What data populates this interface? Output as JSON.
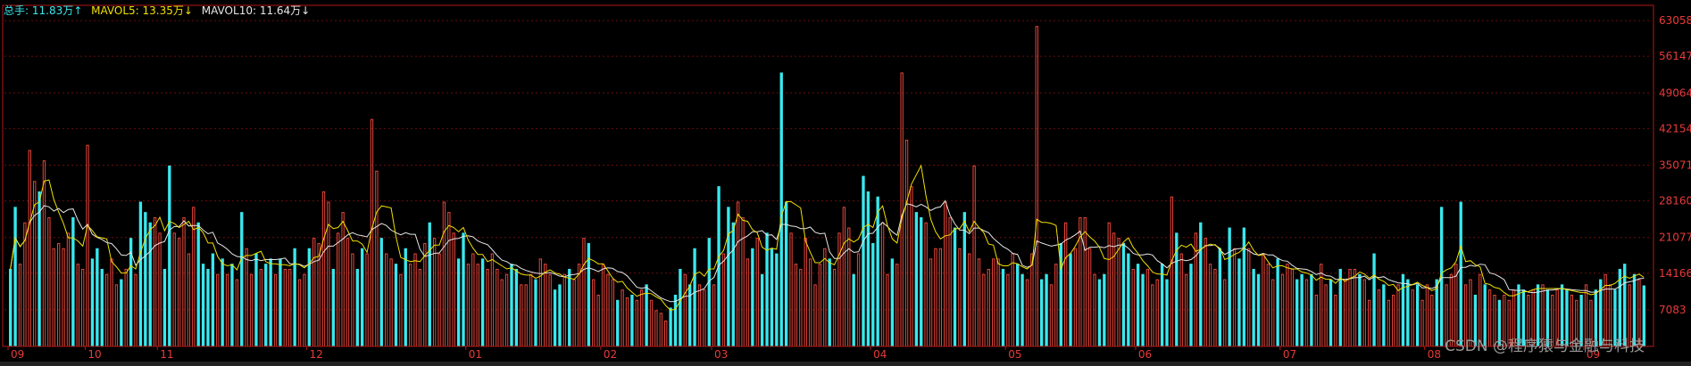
{
  "legend": {
    "total_label": "总手: 11.83万↑",
    "mavol5_label": "MAVOL5: 13.35万↓",
    "mavol10_label": "MAVOL10: 11.64万↓",
    "colors": {
      "total": "#38e8ee",
      "mavol5": "#f0e000",
      "mavol10": "#e6e6e6"
    }
  },
  "watermark": "CSDN @程序猿与金融与科技",
  "chart_data": {
    "type": "bar",
    "title": "",
    "ylim": [
      0,
      66000
    ],
    "y_ticks": [
      7083,
      14166,
      21077,
      28160,
      35071,
      42154,
      49064,
      56147,
      63058
    ],
    "x_month_labels": [
      "09",
      "10",
      "11",
      "12",
      "01",
      "02",
      "03",
      "04",
      "05",
      "06",
      "07",
      "08",
      "09"
    ],
    "x_month_start_index": [
      0,
      16,
      31,
      62,
      95,
      123,
      146,
      179,
      207,
      234,
      264,
      294,
      327
    ],
    "bar_colors": {
      "up": "#e8463a",
      "down": "#38e8ee"
    },
    "values": [
      15000,
      27000,
      16000,
      24000,
      38000,
      32000,
      30000,
      36000,
      25000,
      19000,
      20000,
      19000,
      22000,
      25000,
      16000,
      15000,
      39000,
      17000,
      19000,
      15000,
      14000,
      17000,
      12000,
      13000,
      15000,
      21000,
      14000,
      28000,
      26000,
      24000,
      25000,
      22000,
      15000,
      35000,
      22000,
      21000,
      25000,
      18000,
      27000,
      24000,
      16000,
      15000,
      18000,
      14000,
      17000,
      14000,
      16000,
      13000,
      26000,
      19000,
      14000,
      18000,
      15000,
      16000,
      17000,
      14000,
      17000,
      15000,
      15000,
      19000,
      13000,
      14000,
      19000,
      21000,
      20000,
      30000,
      28000,
      15000,
      22000,
      26000,
      21000,
      18000,
      15000,
      19000,
      18000,
      44000,
      34000,
      21000,
      18000,
      17000,
      16000,
      14000,
      19000,
      16000,
      18000,
      15000,
      20000,
      24000,
      21000,
      18000,
      28000,
      26000,
      22000,
      17000,
      22000,
      16000,
      18000,
      16000,
      17000,
      15000,
      18000,
      15000,
      13000,
      14000,
      16000,
      15000,
      12000,
      12000,
      14000,
      13000,
      17000,
      16000,
      14000,
      11000,
      12000,
      14000,
      15000,
      13000,
      16000,
      21000,
      20000,
      13000,
      10000,
      16000,
      14000,
      13000,
      9000,
      11000,
      9500,
      10000,
      9000,
      11000,
      12000,
      9000,
      7000,
      6500,
      5000,
      7500,
      10000,
      15000,
      14000,
      12000,
      19000,
      12000,
      11000,
      21000,
      12000,
      31000,
      18000,
      27000,
      24000,
      28000,
      25000,
      17000,
      19000,
      21000,
      14000,
      22000,
      19000,
      18000,
      53000,
      28000,
      22000,
      16000,
      15000,
      21000,
      17000,
      12000,
      16000,
      19000,
      17000,
      15000,
      22000,
      27000,
      23000,
      14000,
      18000,
      33000,
      30000,
      20000,
      29000,
      24000,
      14000,
      17000,
      16000,
      53000,
      40000,
      31000,
      26000,
      25000,
      24000,
      17000,
      19000,
      19000,
      28000,
      25000,
      23000,
      19000,
      26000,
      18000,
      35000,
      17000,
      14000,
      15000,
      17000,
      17000,
      15000,
      14000,
      18000,
      16000,
      14000,
      13000,
      18000,
      62000,
      13000,
      14000,
      12000,
      16000,
      20000,
      24000,
      18000,
      19000,
      25000,
      25000,
      19000,
      14000,
      13000,
      14000,
      24000,
      22000,
      21000,
      20000,
      18000,
      15000,
      16000,
      14000,
      15000,
      12000,
      13000,
      16000,
      13000,
      29000,
      22000,
      18000,
      14000,
      16000,
      22000,
      24000,
      21000,
      16000,
      15000,
      19000,
      13000,
      23000,
      19000,
      17000,
      23000,
      19000,
      15000,
      14000,
      18000,
      16000,
      13000,
      17000,
      14000,
      16000,
      15000,
      13000,
      14000,
      13000,
      14000,
      10000,
      16000,
      12000,
      13000,
      10000,
      15000,
      13000,
      15000,
      15000,
      14000,
      13000,
      9000,
      18000,
      11000,
      12000,
      9000,
      10000,
      12000,
      14000,
      13000,
      11000,
      12000,
      9000,
      12000,
      10000,
      13000,
      27000,
      12000,
      14000,
      16000,
      28000,
      12000,
      13000,
      10000,
      14000,
      12000,
      11000,
      10000,
      9000,
      10000,
      9000,
      11000,
      12000,
      11000,
      10000,
      11000,
      12000,
      12000,
      11000,
      10000,
      11000,
      12000,
      11000,
      10000,
      9000,
      10000,
      12000,
      9000,
      11000,
      13000,
      14000,
      12000,
      11000,
      15000,
      16000,
      12000,
      14000,
      13000,
      11800
    ],
    "up": [
      0,
      0,
      1,
      1,
      1,
      1,
      0,
      1,
      1,
      1,
      1,
      1,
      1,
      0,
      1,
      1,
      1,
      0,
      0,
      0,
      1,
      1,
      1,
      0,
      1,
      0,
      1,
      0,
      0,
      0,
      1,
      1,
      0,
      0,
      1,
      1,
      1,
      1,
      1,
      0,
      0,
      0,
      0,
      1,
      0,
      1,
      0,
      1,
      0,
      1,
      1,
      0,
      1,
      0,
      0,
      1,
      0,
      1,
      1,
      0,
      1,
      1,
      0,
      1,
      1,
      1,
      1,
      0,
      1,
      1,
      1,
      1,
      0,
      0,
      1,
      1,
      1,
      0,
      1,
      1,
      0,
      1,
      0,
      1,
      1,
      1,
      1,
      0,
      1,
      1,
      1,
      1,
      1,
      0,
      0,
      1,
      1,
      1,
      0,
      1,
      1,
      1,
      1,
      1,
      0,
      0,
      1,
      1,
      1,
      0,
      1,
      1,
      1,
      0,
      0,
      1,
      0,
      1,
      1,
      1,
      0,
      1,
      1,
      1,
      1,
      1,
      0,
      1,
      1,
      0,
      1,
      1,
      0,
      1,
      1,
      1,
      1,
      0,
      0,
      0,
      1,
      0,
      0,
      1,
      1,
      0,
      1,
      0,
      1,
      0,
      0,
      1,
      1,
      1,
      0,
      1,
      0,
      0,
      0,
      0,
      0,
      0,
      1,
      1,
      1,
      1,
      1,
      1,
      1,
      1,
      0,
      1,
      1,
      1,
      1,
      0,
      1,
      0,
      0,
      0,
      0,
      1,
      1,
      0,
      1,
      1,
      1,
      1,
      0,
      0,
      1,
      1,
      1,
      1,
      1,
      1,
      0,
      1,
      0,
      1,
      1,
      1,
      1,
      1,
      1,
      1,
      0,
      1,
      1,
      0,
      0,
      1,
      1,
      1,
      0,
      0,
      1,
      1,
      0,
      1,
      0,
      1,
      1,
      1,
      1,
      1,
      0,
      0,
      1,
      1,
      1,
      0,
      0,
      1,
      0,
      0,
      1,
      1,
      1,
      0,
      0,
      1,
      0,
      1,
      1,
      0,
      1,
      0,
      1,
      1,
      1,
      0,
      1,
      0,
      1,
      0,
      0,
      1,
      0,
      0,
      1,
      1,
      1,
      0,
      1,
      1,
      1,
      0,
      0,
      1,
      0,
      1,
      1,
      1,
      0,
      1,
      0,
      1,
      1,
      1,
      0,
      1,
      1,
      0,
      1,
      0,
      1,
      1,
      1,
      0,
      0,
      1,
      0,
      1,
      1,
      1,
      0,
      0,
      1,
      1,
      1,
      0,
      1,
      1,
      0,
      1,
      0,
      1,
      1,
      0,
      1,
      1,
      1,
      0,
      0,
      1,
      1,
      0,
      1,
      0,
      1,
      1,
      0,
      0,
      1,
      1,
      0,
      1,
      1,
      0,
      0,
      1,
      1,
      0,
      0,
      0,
      1,
      0,
      1,
      0,
      0,
      1,
      1,
      1,
      0,
      0,
      0,
      1,
      0,
      0,
      0,
      1,
      0,
      0,
      1,
      1,
      1,
      0,
      0,
      1,
      0,
      0,
      0,
      0,
      0,
      0
    ]
  }
}
